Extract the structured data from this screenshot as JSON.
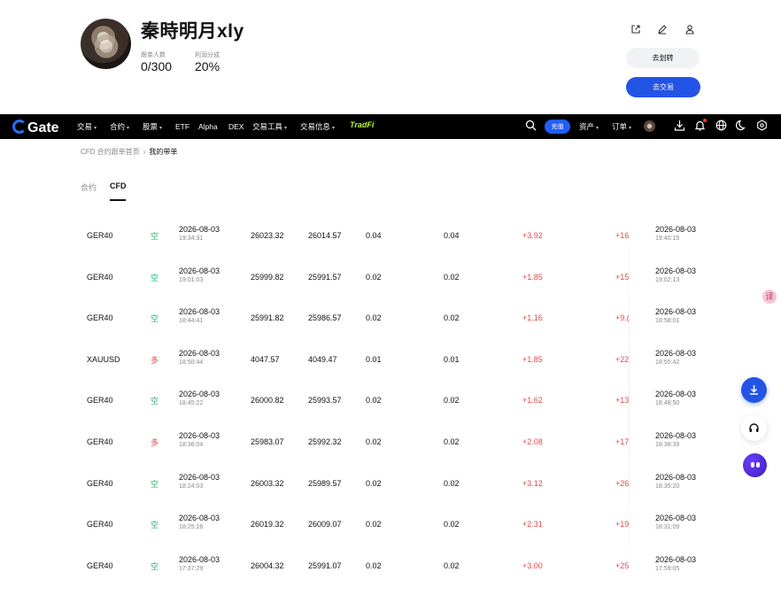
{
  "profile": {
    "name": "秦時明月xly",
    "followers_label": "跟单人数",
    "followers_value": "0/300",
    "profit_share_label": "利润分成",
    "profit_share_value": "20%",
    "transfer_button": "去划转",
    "trade_button": "去交易",
    "icons": [
      "share-icon",
      "edit-icon",
      "user-icon"
    ]
  },
  "nav": {
    "brand": "Gate",
    "items": [
      {
        "label": "交易",
        "caret": true
      },
      {
        "label": "合约",
        "caret": true
      },
      {
        "label": "股票",
        "caret": true
      },
      {
        "label": "ETF",
        "caret": false
      },
      {
        "label": "Alpha",
        "caret": false
      },
      {
        "label": "DEX",
        "caret": false
      },
      {
        "label": "交易工具",
        "caret": true
      },
      {
        "label": "交易信息",
        "caret": true
      }
    ],
    "tradfi": "TradFi",
    "recharge": "充值",
    "assets": "资产",
    "orders": "订单",
    "caret": "▾",
    "accent": "#2354e6"
  },
  "breadcrumb": {
    "parent": "CFD 合约跟单首页",
    "separator": "›",
    "current": "我的带单"
  },
  "tabs": [
    "合约",
    "CFD"
  ],
  "active_tab": "CFD",
  "colors": {
    "short": "#20b26c",
    "long": "#e5484d",
    "profit": "#e5484d"
  },
  "rows": [
    {
      "symbol": "GER40",
      "side": "空",
      "side_type": "short",
      "open_date": "2026-08-03",
      "open_time": "19:34:31",
      "open_price": "26023.32",
      "close_price": "26014.57",
      "qty1": "0.04",
      "qty2": "0.04",
      "pnl": "+3.92",
      "pnl2": "+16",
      "close_date": "2026-08-03",
      "close_time": "19:40:15"
    },
    {
      "symbol": "GER40",
      "side": "空",
      "side_type": "short",
      "open_date": "2026-08-03",
      "open_time": "19:01:03",
      "open_price": "25999.82",
      "close_price": "25991.57",
      "qty1": "0.02",
      "qty2": "0.02",
      "pnl": "+1.85",
      "pnl2": "+15",
      "close_date": "2026-08-03",
      "close_time": "19:02:13"
    },
    {
      "symbol": "GER40",
      "side": "空",
      "side_type": "short",
      "open_date": "2026-08-03",
      "open_time": "18:44:41",
      "open_price": "25991.82",
      "close_price": "25986.57",
      "qty1": "0.02",
      "qty2": "0.02",
      "pnl": "+1.16",
      "pnl2": "+9.(",
      "close_date": "2026-08-03",
      "close_time": "18:58:01"
    },
    {
      "symbol": "XAUUSD",
      "side": "多",
      "side_type": "long",
      "open_date": "2026-08-03",
      "open_time": "18:50:44",
      "open_price": "4047.57",
      "close_price": "4049.47",
      "qty1": "0.01",
      "qty2": "0.01",
      "pnl": "+1.85",
      "pnl2": "+22",
      "close_date": "2026-08-03",
      "close_time": "18:55:42"
    },
    {
      "symbol": "GER40",
      "side": "空",
      "side_type": "short",
      "open_date": "2026-08-03",
      "open_time": "18:45:22",
      "open_price": "26000.82",
      "close_price": "25993.57",
      "qty1": "0.02",
      "qty2": "0.02",
      "pnl": "+1.62",
      "pnl2": "+13",
      "close_date": "2026-08-03",
      "close_time": "18:48:50"
    },
    {
      "symbol": "GER40",
      "side": "多",
      "side_type": "long",
      "open_date": "2026-08-03",
      "open_time": "18:36:04",
      "open_price": "25983.07",
      "close_price": "25992.32",
      "qty1": "0.02",
      "qty2": "0.02",
      "pnl": "+2.08",
      "pnl2": "+17",
      "close_date": "2026-08-03",
      "close_time": "18:38:39"
    },
    {
      "symbol": "GER40",
      "side": "空",
      "side_type": "short",
      "open_date": "2026-08-03",
      "open_time": "18:24:03",
      "open_price": "26003.32",
      "close_price": "25989.57",
      "qty1": "0.02",
      "qty2": "0.02",
      "pnl": "+3.12",
      "pnl2": "+26",
      "close_date": "2026-08-03",
      "close_time": "18:35:20"
    },
    {
      "symbol": "GER40",
      "side": "空",
      "side_type": "short",
      "open_date": "2026-08-03",
      "open_time": "18:25:16",
      "open_price": "26019.32",
      "close_price": "26009.07",
      "qty1": "0.02",
      "qty2": "0.02",
      "pnl": "+2.31",
      "pnl2": "+19",
      "close_date": "2026-08-03",
      "close_time": "18:31:09"
    },
    {
      "symbol": "GER40",
      "side": "空",
      "side_type": "short",
      "open_date": "2026-08-03",
      "open_time": "17:37:29",
      "open_price": "26004.32",
      "close_price": "25991.07",
      "qty1": "0.02",
      "qty2": "0.02",
      "pnl": "+3.00",
      "pnl2": "+25",
      "close_date": "2026-08-03",
      "close_time": "17:59:05"
    }
  ],
  "floating": {
    "translate": "译"
  }
}
